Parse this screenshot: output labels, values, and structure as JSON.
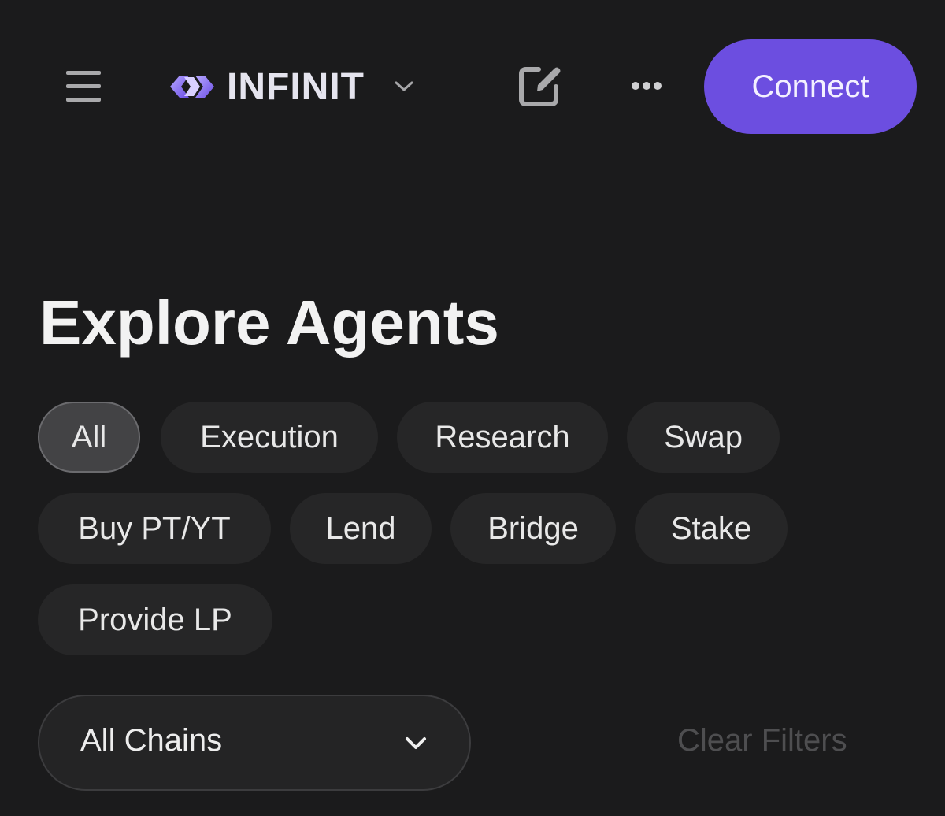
{
  "header": {
    "brand_name": "INFINIT",
    "connect_label": "Connect",
    "accent_color": "#6c4ee0",
    "icons": {
      "menu": "hamburger-menu-icon",
      "logo": "infinity-logo-icon",
      "brand_dropdown": "chevron-down-icon",
      "compose": "edit-icon",
      "more": "more-horizontal-icon"
    }
  },
  "main": {
    "title": "Explore Agents",
    "filters": [
      {
        "label": "All",
        "selected": true
      },
      {
        "label": "Execution",
        "selected": false
      },
      {
        "label": "Research",
        "selected": false
      },
      {
        "label": "Swap",
        "selected": false
      },
      {
        "label": "Buy PT/YT",
        "selected": false
      },
      {
        "label": "Lend",
        "selected": false
      },
      {
        "label": "Bridge",
        "selected": false
      },
      {
        "label": "Stake",
        "selected": false
      },
      {
        "label": "Provide LP",
        "selected": false
      }
    ],
    "chain_select": {
      "value": "All Chains"
    },
    "clear_filters_label": "Clear Filters"
  }
}
